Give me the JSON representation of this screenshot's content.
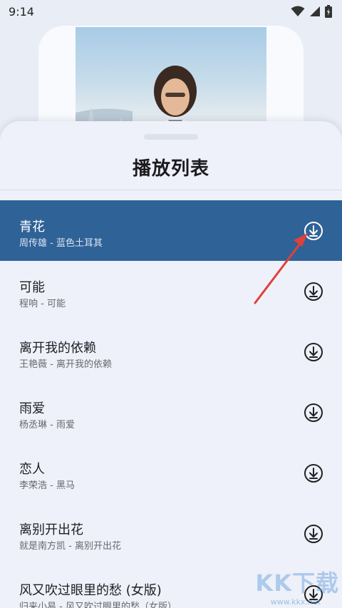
{
  "status_bar": {
    "time": "9:14"
  },
  "sheet": {
    "title": "播放列表"
  },
  "songs": [
    {
      "title": "青花",
      "subtitle": "周传雄 - 蓝色土耳其",
      "active": true
    },
    {
      "title": "可能",
      "subtitle": "程响 - 可能",
      "active": false
    },
    {
      "title": "离开我的依赖",
      "subtitle": "王艳薇 - 离开我的依赖",
      "active": false
    },
    {
      "title": "雨爱",
      "subtitle": "杨丞琳 - 雨爱",
      "active": false
    },
    {
      "title": "恋人",
      "subtitle": "李荣浩 - 黑马",
      "active": false
    },
    {
      "title": "离别开出花",
      "subtitle": "就是南方凯 - 离别开出花",
      "active": false
    },
    {
      "title": "风又吹过眼里的愁 (女版)",
      "subtitle": "归来小易 - 风又吹过眼里的愁（女版）",
      "active": false
    }
  ],
  "icons": {
    "status": [
      "wifi-icon",
      "signal-icon",
      "battery-icon"
    ],
    "row_action": "download-icon"
  },
  "colors": {
    "active_row": "#2f6297",
    "background": "#e9edf6",
    "annotation_arrow": "#e0403a"
  },
  "watermark": {
    "text": "KK下载",
    "url": "www.kkx.net"
  }
}
